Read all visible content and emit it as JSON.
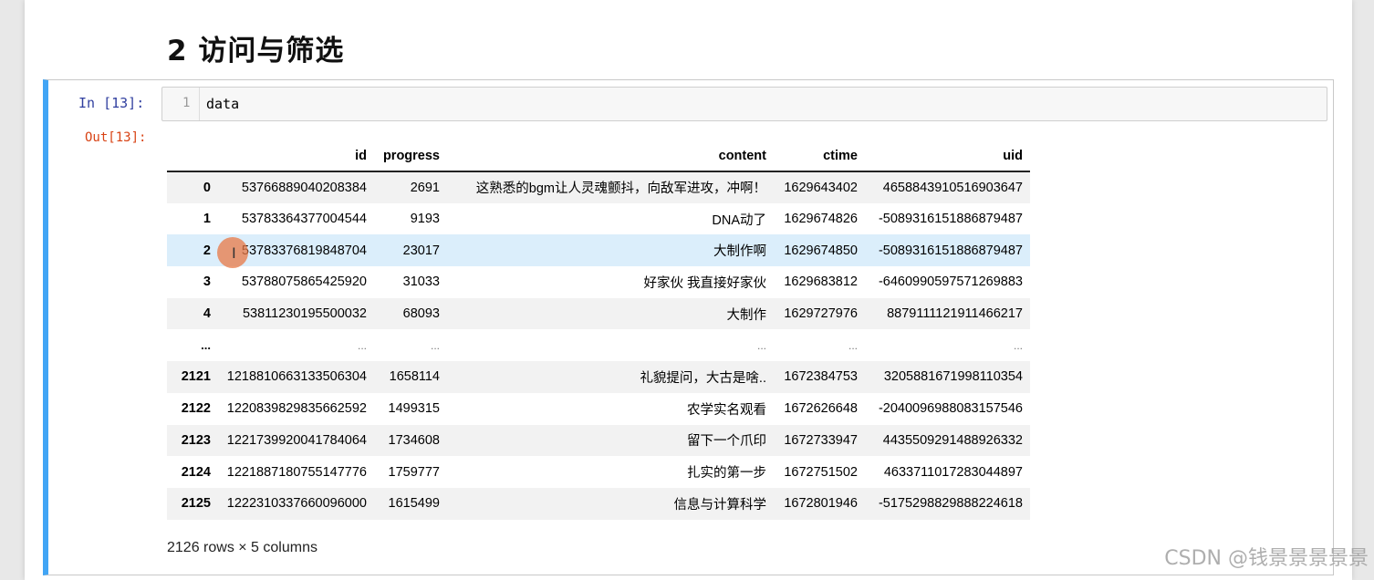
{
  "notebook": {
    "heading": "2  访问与筛选",
    "cell": {
      "in_prompt": "In  [13]:",
      "out_prompt": "Out[13]:",
      "line_number": "1",
      "code": "data"
    },
    "dataframe": {
      "columns": [
        "",
        "id",
        "progress",
        "content",
        "ctime",
        "uid"
      ],
      "rows": [
        {
          "idx": "0",
          "id": "53766889040208384",
          "progress": "2691",
          "content": "这熟悉的bgm让人灵魂颤抖，向敌军进攻，冲啊！",
          "ctime": "1629643402",
          "uid": "4658843910516903647"
        },
        {
          "idx": "1",
          "id": "53783364377004544",
          "progress": "9193",
          "content": "DNA动了",
          "ctime": "1629674826",
          "uid": "-5089316151886879487"
        },
        {
          "idx": "2",
          "id": "53783376819848704",
          "progress": "23017",
          "content": "大制作啊",
          "ctime": "1629674850",
          "uid": "-5089316151886879487"
        },
        {
          "idx": "3",
          "id": "53788075865425920",
          "progress": "31033",
          "content": "好家伙 我直接好家伙",
          "ctime": "1629683812",
          "uid": "-6460990597571269883"
        },
        {
          "idx": "4",
          "id": "53811230195500032",
          "progress": "68093",
          "content": "大制作",
          "ctime": "1629727976",
          "uid": "8879111121911466217"
        },
        {
          "idx": "...",
          "id": "...",
          "progress": "...",
          "content": "...",
          "ctime": "...",
          "uid": "..."
        },
        {
          "idx": "2121",
          "id": "1218810663133506304",
          "progress": "1658114",
          "content": "礼貌提问，大古是啥..",
          "ctime": "1672384753",
          "uid": "3205881671998110354"
        },
        {
          "idx": "2122",
          "id": "1220839829835662592",
          "progress": "1499315",
          "content": "农学实名观看",
          "ctime": "1672626648",
          "uid": "-2040096988083157546"
        },
        {
          "idx": "2123",
          "id": "1221739920041784064",
          "progress": "1734608",
          "content": "留下一个爪印",
          "ctime": "1672733947",
          "uid": "4435509291488926332"
        },
        {
          "idx": "2124",
          "id": "1221887180755147776",
          "progress": "1759777",
          "content": "扎实的第一步",
          "ctime": "1672751502",
          "uid": "4633711017283044897"
        },
        {
          "idx": "2125",
          "id": "1222310337660096000",
          "progress": "1615499",
          "content": "信息与计算科学",
          "ctime": "1672801946",
          "uid": "-5175298829888224618"
        }
      ],
      "shape_info": "2126 rows × 5 columns"
    }
  },
  "watermark": "CSDN @钱景景景景景",
  "colors": {
    "cell_accent": "#42a5f5",
    "in_prompt": "#303f9f",
    "out_prompt": "#d84315",
    "hover_row": "#dbeefb",
    "cursor": "#e87846"
  }
}
